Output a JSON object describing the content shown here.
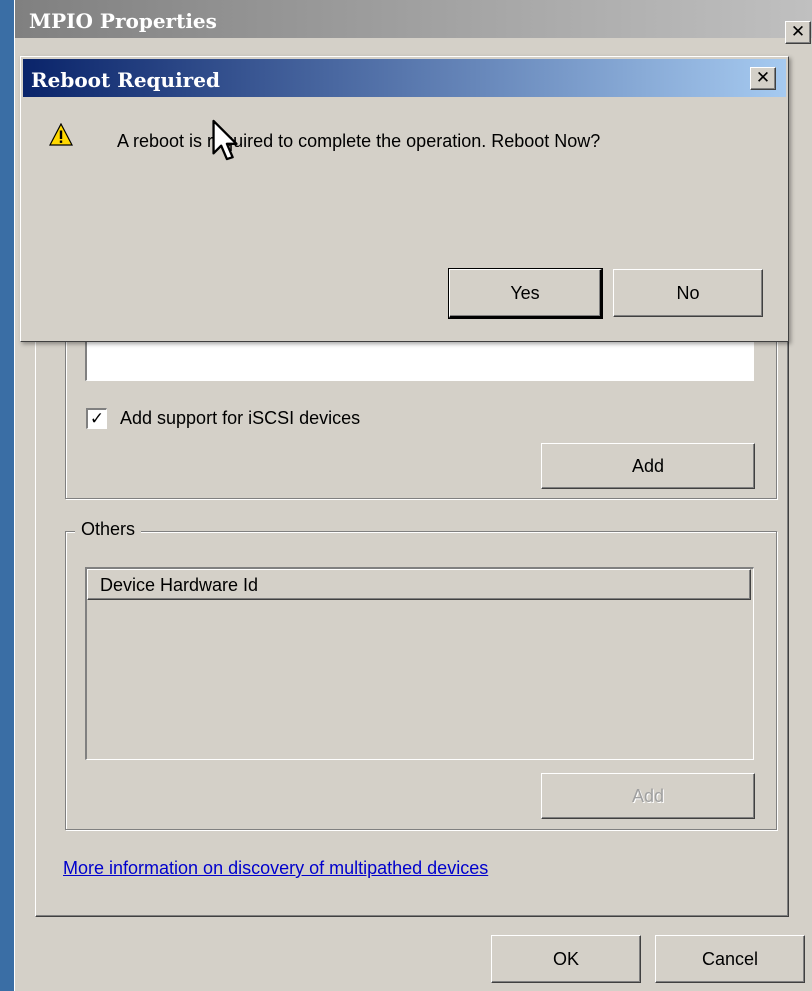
{
  "main_window": {
    "title": "MPIO Properties",
    "close_glyph": "✕",
    "checkbox": {
      "label": "Add support for iSCSI devices",
      "checked": true
    },
    "add_iscsi_button": "Add",
    "others_group": {
      "label": "Others",
      "column_header": "Device Hardware Id",
      "add_button": "Add",
      "add_button_disabled": true
    },
    "info_link": "More information on discovery of multipathed devices",
    "ok_button": "OK",
    "cancel_button": "Cancel"
  },
  "dialog": {
    "title": "Reboot Required",
    "close_glyph": "✕",
    "icon": "warning-icon",
    "message": "A reboot is required to complete the operation. Reboot Now?",
    "yes_button": "Yes",
    "no_button": "No"
  },
  "colors": {
    "dialog_title_start": "#0a246a",
    "dialog_title_end": "#a6caf0",
    "inactive_title_start": "#808080",
    "face": "#d4d0c8",
    "link": "#0000cc",
    "warning_yellow": "#ffd800"
  }
}
